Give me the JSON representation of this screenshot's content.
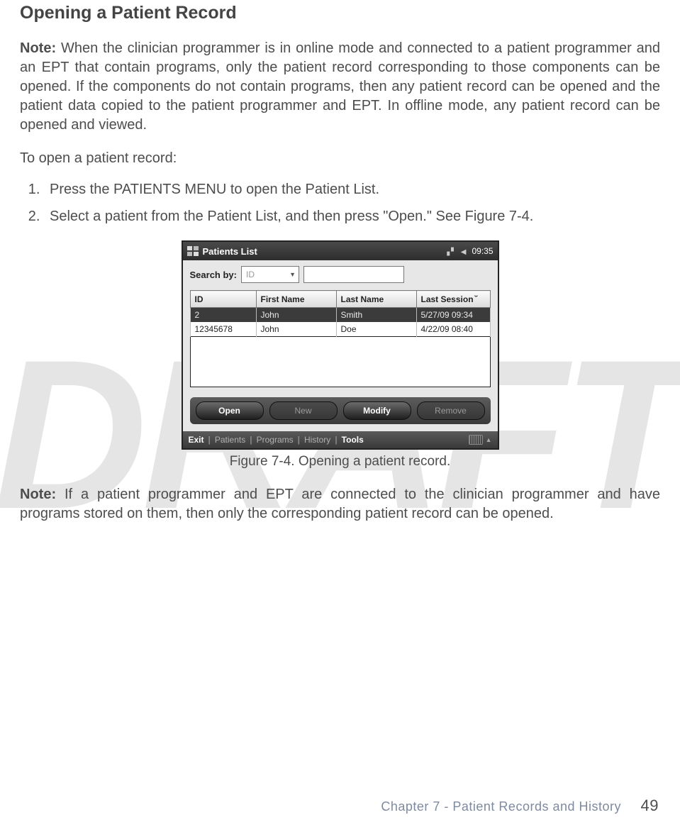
{
  "watermark": "DRAFT",
  "title": "Opening a Patient Record",
  "note1_label": "Note:",
  "note1_body": " When the clinician programmer is in online mode and connected to a patient programmer and an EPT that contain programs, only the patient record corresponding to those components can be opened. If the components do not contain programs, then any patient record can be opened and the patient data copied to the patient programmer and EPT. In offline mode, any patient record can be opened and viewed.",
  "lead": "To open a patient record:",
  "steps": [
    "Press the PATIENTS MENU to open the Patient List.",
    "Select a patient from the Patient List, and then press \"Open.\" See Figure 7-4."
  ],
  "caption": "Figure 7-4. Opening a patient record.",
  "note2_label": "Note:",
  "note2_body": " If a patient programmer and EPT are connected to the clinician programmer and have programs stored on them, then only the corresponding patient record can be opened.",
  "footer_chapter": "Chapter 7 - Patient Records and History",
  "footer_page": "49",
  "device": {
    "title": "Patients List",
    "time": "09:35",
    "search_label": "Search by:",
    "search_field": "ID",
    "headers": {
      "id": "ID",
      "first": "First Name",
      "last": "Last Name",
      "session": "Last Session"
    },
    "rows": [
      {
        "id": "2",
        "first": "John",
        "last": "Smith",
        "session": "5/27/09 09:34"
      },
      {
        "id": "12345678",
        "first": "John",
        "last": "Doe",
        "session": "4/22/09 08:40"
      }
    ],
    "buttons": {
      "open": "Open",
      "new": "New",
      "modify": "Modify",
      "remove": "Remove"
    },
    "menu": {
      "exit": "Exit",
      "patients": "Patients",
      "programs": "Programs",
      "history": "History",
      "tools": "Tools"
    }
  }
}
